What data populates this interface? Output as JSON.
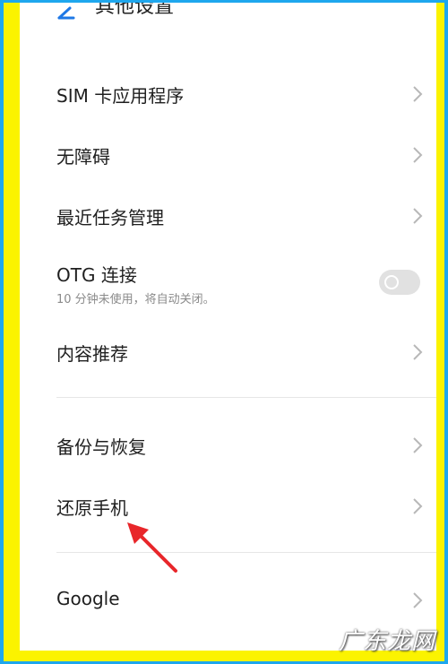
{
  "header": {
    "title": "其他设置"
  },
  "items": [
    {
      "label": "SIM 卡应用程序"
    },
    {
      "label": "无障碍"
    },
    {
      "label": "最近任务管理"
    },
    {
      "label": "OTG 连接",
      "sub": "10 分钟未使用，将自动关闭。",
      "toggle_on": false
    },
    {
      "label": "内容推荐"
    },
    {
      "label": "备份与恢复"
    },
    {
      "label": "还原手机"
    },
    {
      "label": "Google"
    }
  ],
  "watermark": "广东龙网",
  "colors": {
    "outer_border": "#1ea7ee",
    "inner_border": "#fbf300",
    "annotation_arrow": "#e8262a"
  }
}
